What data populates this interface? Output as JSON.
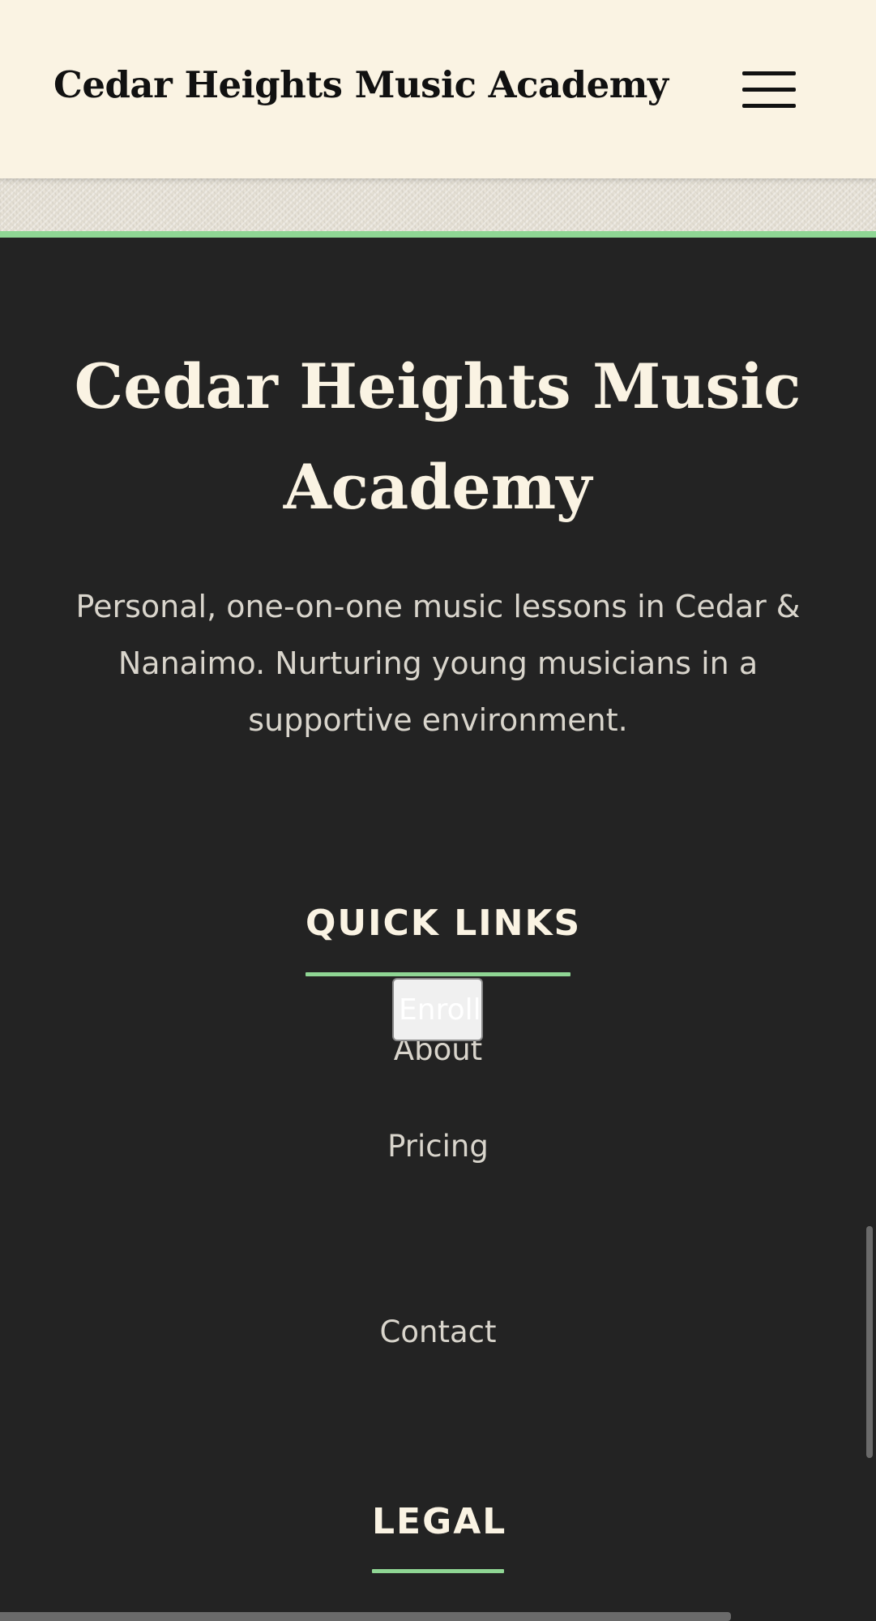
{
  "header": {
    "brand": "Cedar Heights Music Academy",
    "menu_icon": "hamburger-menu-icon"
  },
  "footer": {
    "title": "Cedar Heights Music Academy",
    "tagline": "Personal, one-on-one music lessons in Cedar & Nanaimo. Nurturing young musicians in a supportive environment.",
    "quick_links": {
      "heading": "QUICK LINKS",
      "items": {
        "about": "About",
        "pricing": "Pricing",
        "enroll": "Enroll",
        "contact": "Contact"
      }
    },
    "legal": {
      "heading": "LEGAL"
    }
  },
  "colors": {
    "header_bg": "#faf3e3",
    "footer_bg": "#232323",
    "accent_green": "#8fd694",
    "heading_text": "#faf3e3",
    "body_text": "#d9d5cc"
  }
}
